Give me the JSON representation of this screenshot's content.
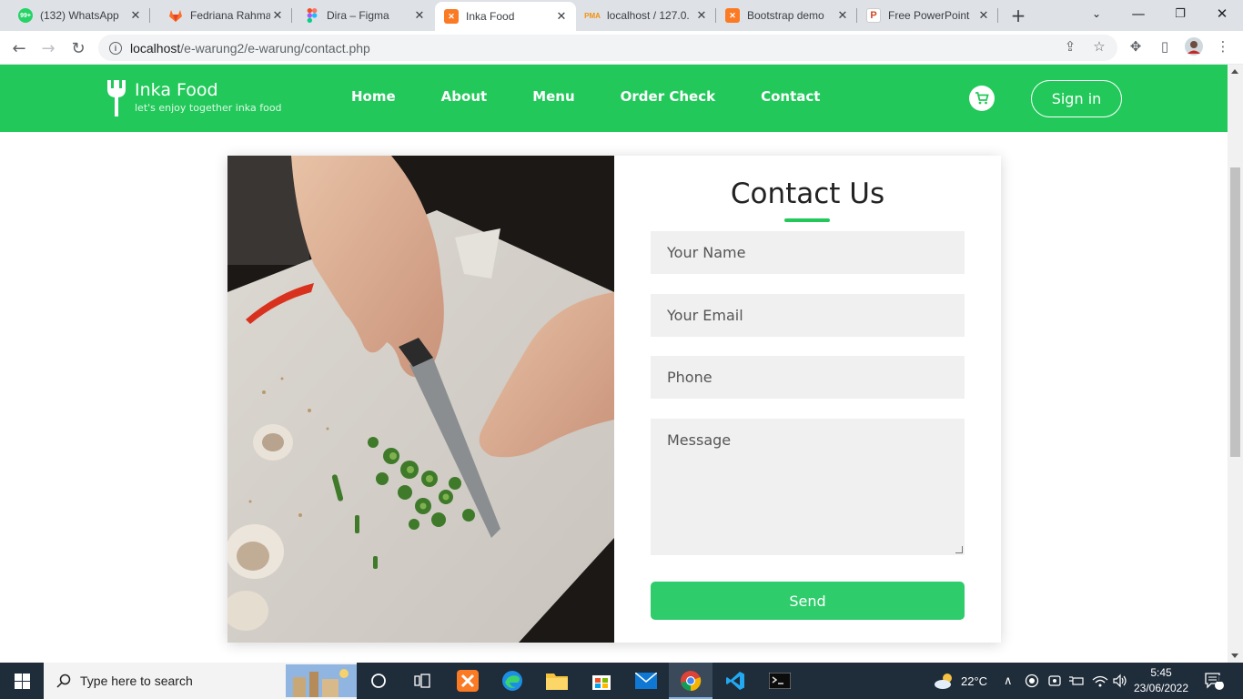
{
  "browser": {
    "tabs": [
      {
        "title": "(132) WhatsApp",
        "icon": "whatsapp-icon",
        "color": "#25d366",
        "badge": "99+",
        "active": false
      },
      {
        "title": "Fedriana Rahman",
        "icon": "gitlab-icon",
        "color": "#fc6d26",
        "active": false
      },
      {
        "title": "Dira – Figma",
        "icon": "figma-icon",
        "color": "#a259ff",
        "active": false
      },
      {
        "title": "Inka Food",
        "icon": "xampp-icon",
        "color": "#fb7a24",
        "active": true
      },
      {
        "title": "localhost / 127.0.",
        "icon": "phpmyadmin-icon",
        "color": "#f29111",
        "active": false
      },
      {
        "title": "Bootstrap demo",
        "icon": "xampp-icon",
        "color": "#fb7a24",
        "active": false
      },
      {
        "title": "Free PowerPoint",
        "icon": "powerpoint-icon",
        "color": "#d24726",
        "active": false
      }
    ],
    "url_host": "localhost",
    "url_path": "/e-warung2/e-warung/contact.php"
  },
  "site": {
    "brand": "Inka Food",
    "tagline": "let's enjoy together inka food",
    "nav": [
      "Home",
      "About",
      "Menu",
      "Order Check",
      "Contact"
    ],
    "signin": "Sign in",
    "accent": "#22c95a"
  },
  "contact": {
    "title": "Contact Us",
    "name_placeholder": "Your Name",
    "email_placeholder": "Your Email",
    "phone_placeholder": "Phone",
    "message_placeholder": "Message",
    "send": "Send"
  },
  "taskbar": {
    "search_placeholder": "Type here to search",
    "weather": "22°C",
    "time": "5:45",
    "date": "23/06/2022",
    "notifications": "1"
  }
}
